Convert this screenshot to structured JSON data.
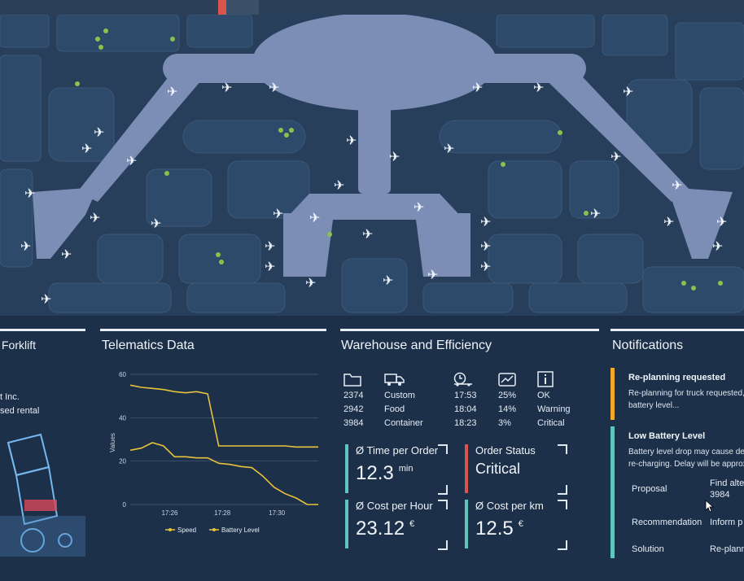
{
  "top_strip": {
    "accent": "#d9534f"
  },
  "forklift": {
    "title": "Forklift",
    "lines": [
      "t Inc.",
      "sed rental"
    ]
  },
  "telematics": {
    "title": "Telematics Data",
    "ylabel": "Values",
    "legend_speed": "Speed",
    "legend_battery": "Battery Level"
  },
  "chart_data": {
    "type": "line",
    "title": "Telematics Data",
    "ylabel": "Values",
    "xlabel": "",
    "ylim": [
      0,
      60
    ],
    "yticks": [
      "0",
      "20",
      "40",
      "60"
    ],
    "xticks": [
      "17:26",
      "17:28",
      "17:30"
    ],
    "grid": true,
    "legend": "bottom",
    "x": [
      "17:25.0",
      "17:25.3",
      "17:25.6",
      "17:26.0",
      "17:26.5",
      "17:27.0",
      "17:27.5",
      "17:27.7",
      "17:27.75",
      "17:28.0",
      "17:28.5",
      "17:29.0",
      "17:29.5",
      "17:30.0",
      "17:30.5",
      "17:31.0",
      "17:31.5",
      "17:32.0"
    ],
    "series": [
      {
        "name": "Speed",
        "color": "#e8c23a",
        "values": [
          25,
          26,
          28.5,
          27,
          22,
          22,
          21.5,
          21.5,
          19,
          18.5,
          17.5,
          17,
          13,
          8,
          5,
          3,
          0,
          0
        ]
      },
      {
        "name": "Battery Level",
        "color": "#e8c23a",
        "values": [
          55,
          54,
          53.5,
          53,
          52,
          51.5,
          52,
          51,
          27,
          27,
          27,
          27,
          27,
          27,
          27,
          26.5,
          26.5,
          26.5
        ]
      }
    ]
  },
  "warehouse": {
    "title": "Warehouse and Efficiency",
    "col1": [
      "2374",
      "2942",
      "3984"
    ],
    "col2": [
      "Custom",
      "Food",
      "Container"
    ],
    "col3": [
      "17:53",
      "18:04",
      "18:23"
    ],
    "col4": [
      "25%",
      "14%",
      "3%"
    ],
    "col5": [
      "OK",
      "Warning",
      "Critical"
    ],
    "kpi": {
      "time_label": "Ø Time per Order",
      "time_value": "12.3",
      "time_unit": "min",
      "status_label": "Order Status",
      "status_value": "Critical",
      "cost_hour_label": "Ø Cost per Hour",
      "cost_hour_value": "23.12",
      "cost_hour_unit": "€",
      "cost_km_label": "Ø Cost per km",
      "cost_km_value": "12.5",
      "cost_km_unit": "€"
    },
    "colors": {
      "teal": "#5fc6bd",
      "red": "#d9534f"
    }
  },
  "notifications": {
    "title": "Notifications",
    "n1_title": "Re-planning requested",
    "n1_line1": "Re-planning for truck requested,",
    "n1_line2": "battery level...",
    "n2_title": "Low Battery Level",
    "n2_line1": "Battery level drop may cause dela",
    "n2_line2": "re-charging. Delay will be approxi",
    "proposal_label": "Proposal",
    "proposal_value1": "Find alte",
    "proposal_value2": "3984",
    "recommendation_label": "Recommendation",
    "recommendation_value": "Inform p",
    "solution_label": "Solution",
    "solution_value": "Re-plann",
    "colors": {
      "orange": "#f0a92a",
      "teal": "#5fc6bd"
    }
  }
}
